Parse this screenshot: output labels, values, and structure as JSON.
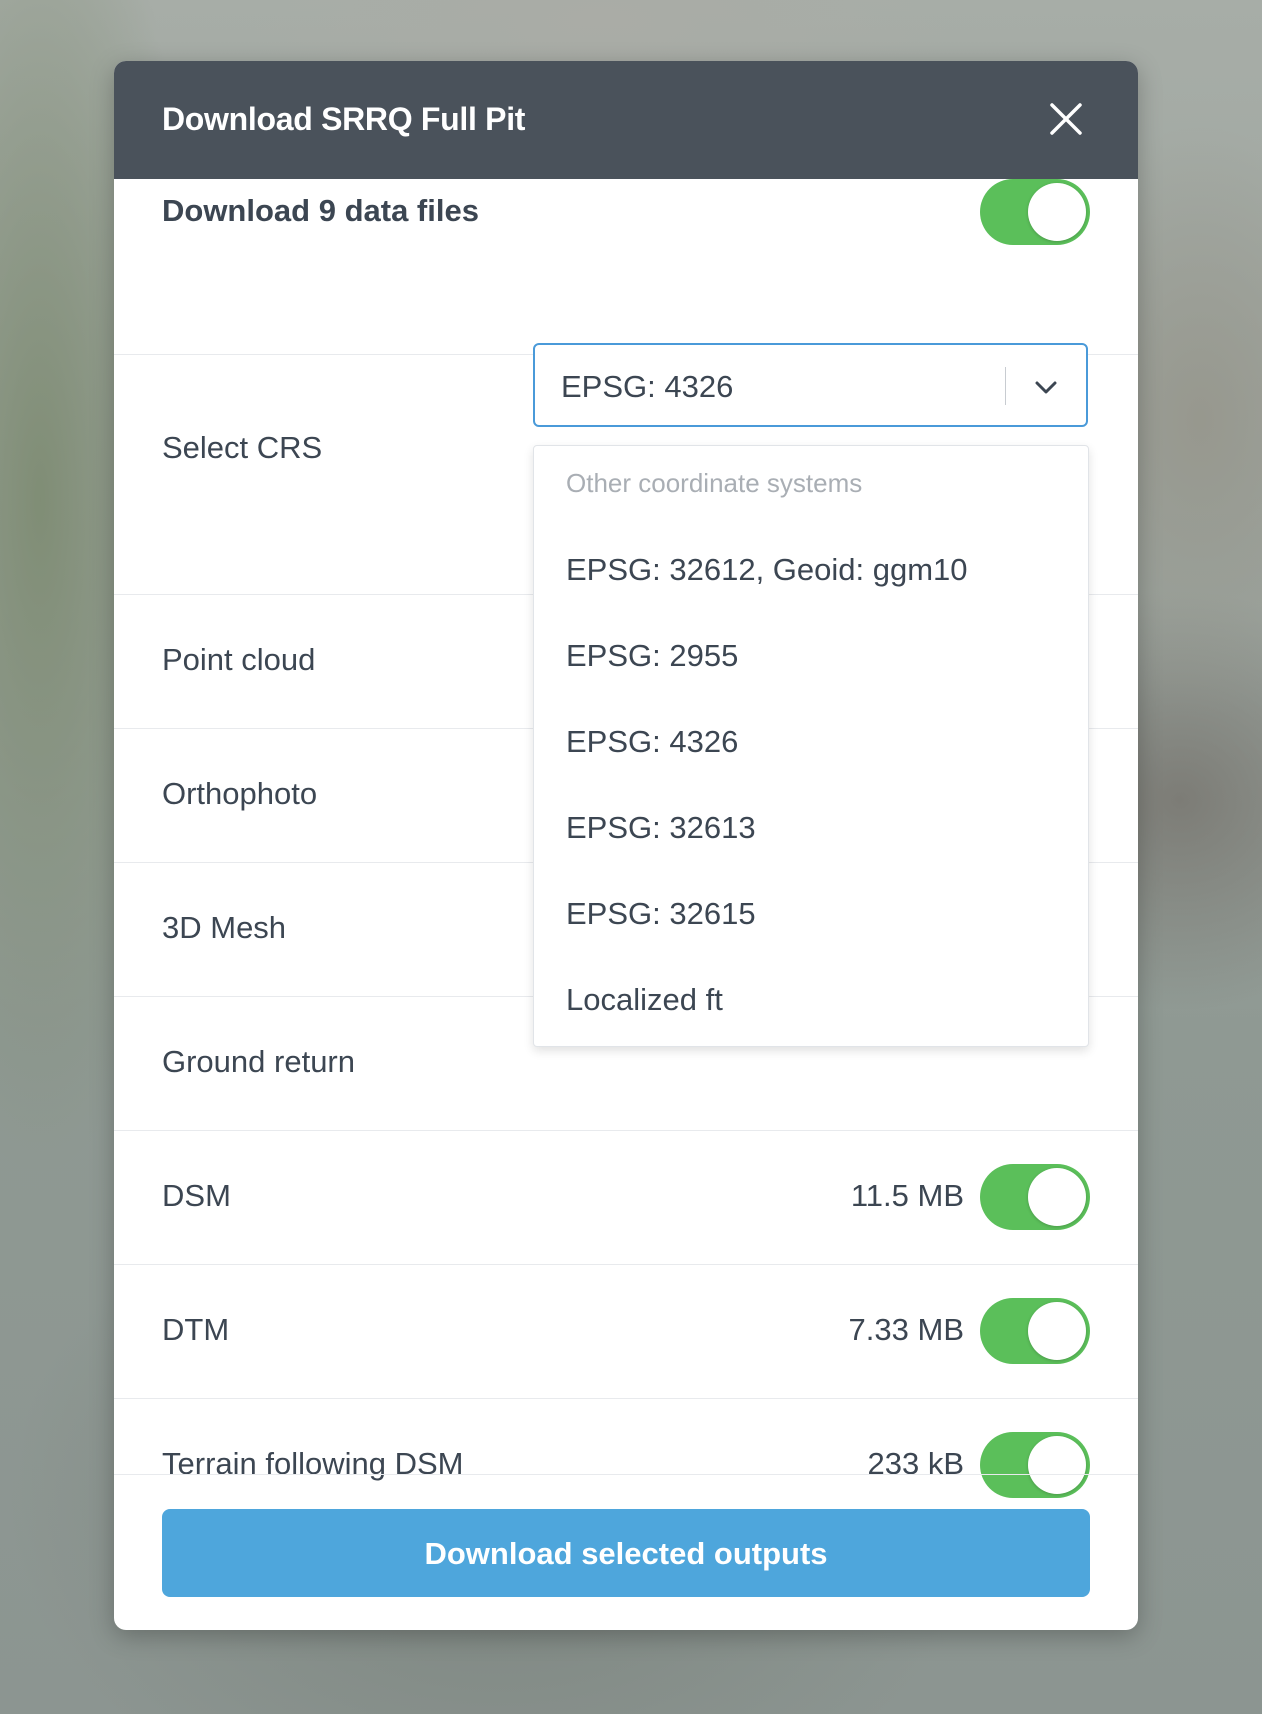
{
  "modal": {
    "title": "Download SRRQ Full Pit",
    "close_icon": "close-icon"
  },
  "download_all": {
    "label": "Download 9 data files",
    "enabled": true
  },
  "crs": {
    "label": "Select CRS",
    "selected": "EPSG: 4326",
    "chevron_icon": "chevron-down-icon",
    "dropdown": {
      "group_label": "Other coordinate systems",
      "options": [
        "EPSG: 32612, Geoid: ggm10",
        "EPSG: 2955",
        "EPSG: 4326",
        "EPSG: 32613",
        "EPSG: 32615",
        "Localized ft"
      ]
    }
  },
  "outputs": [
    {
      "label": "Point cloud",
      "size": "",
      "enabled": true
    },
    {
      "label": "Orthophoto",
      "size": "",
      "enabled": true
    },
    {
      "label": "3D Mesh",
      "size": "",
      "enabled": true
    },
    {
      "label": "Ground return",
      "size": "",
      "enabled": true
    },
    {
      "label": "DSM",
      "size": "11.5 MB",
      "enabled": true
    },
    {
      "label": "DTM",
      "size": "7.33 MB",
      "enabled": true
    },
    {
      "label": "Terrain following DSM",
      "size": "233 kB",
      "enabled": true
    }
  ],
  "footer": {
    "download_button": "Download selected outputs"
  },
  "colors": {
    "header_bg": "#4a525b",
    "toggle_on": "#5bbf5a",
    "primary_button": "#4ea6dc",
    "select_border": "#4a9ad9"
  }
}
